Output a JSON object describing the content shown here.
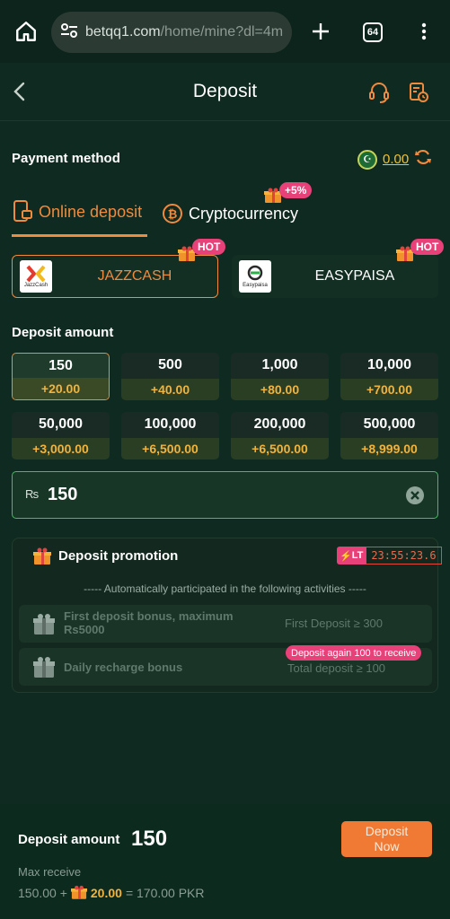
{
  "browser": {
    "url_host": "betqq1.com",
    "url_path": "/home/mine?dl=4m",
    "tab_count": "64"
  },
  "header": {
    "title": "Deposit"
  },
  "payment": {
    "title": "Payment method",
    "balance": "0.00",
    "tabs": [
      {
        "label": "Online deposit"
      },
      {
        "label": "Cryptocurrency",
        "badge": "+5%"
      }
    ],
    "channels": [
      {
        "label": "JAZZCASH",
        "logo_text": "JazzCash",
        "badge": "HOT"
      },
      {
        "label": "EASYPAISA",
        "logo_text": "Easypaisa",
        "badge": "HOT"
      }
    ]
  },
  "amounts": {
    "title": "Deposit amount",
    "options": [
      {
        "amount": "150",
        "bonus": "+20.00"
      },
      {
        "amount": "500",
        "bonus": "+40.00"
      },
      {
        "amount": "1,000",
        "bonus": "+80.00"
      },
      {
        "amount": "10,000",
        "bonus": "+700.00"
      },
      {
        "amount": "50,000",
        "bonus": "+3,000.00"
      },
      {
        "amount": "100,000",
        "bonus": "+6,500.00"
      },
      {
        "amount": "200,000",
        "bonus": "+6,500.00"
      },
      {
        "amount": "500,000",
        "bonus": "+8,999.00"
      }
    ],
    "currency_symbol": "₨",
    "input_value": "150"
  },
  "promotion": {
    "title": "Deposit promotion",
    "timer_badge": "LT",
    "timer": "23:55:23.6",
    "subtitle": "----- Automatically participated in the following activities -----",
    "rows": [
      {
        "name": "First deposit bonus, maximum Rs5000",
        "condition": "First Deposit ≥ 300",
        "tag": ""
      },
      {
        "name": "Daily recharge bonus",
        "condition": "Total deposit ≥ 100",
        "tag": "Deposit again 100 to receive"
      }
    ]
  },
  "footer": {
    "label": "Deposit amount",
    "amount": "150",
    "button": "Deposit Now",
    "max_receive_label": "Max receive",
    "calc_base": "150.00 +",
    "calc_bonus": "20.00",
    "calc_total": "= 170.00 PKR"
  },
  "colors": {
    "accent": "#f08a3c",
    "background": "#0f2a20",
    "hot_badge": "#e8417a",
    "bonus_text": "#f2b33a",
    "input_border": "#3ac25a"
  }
}
